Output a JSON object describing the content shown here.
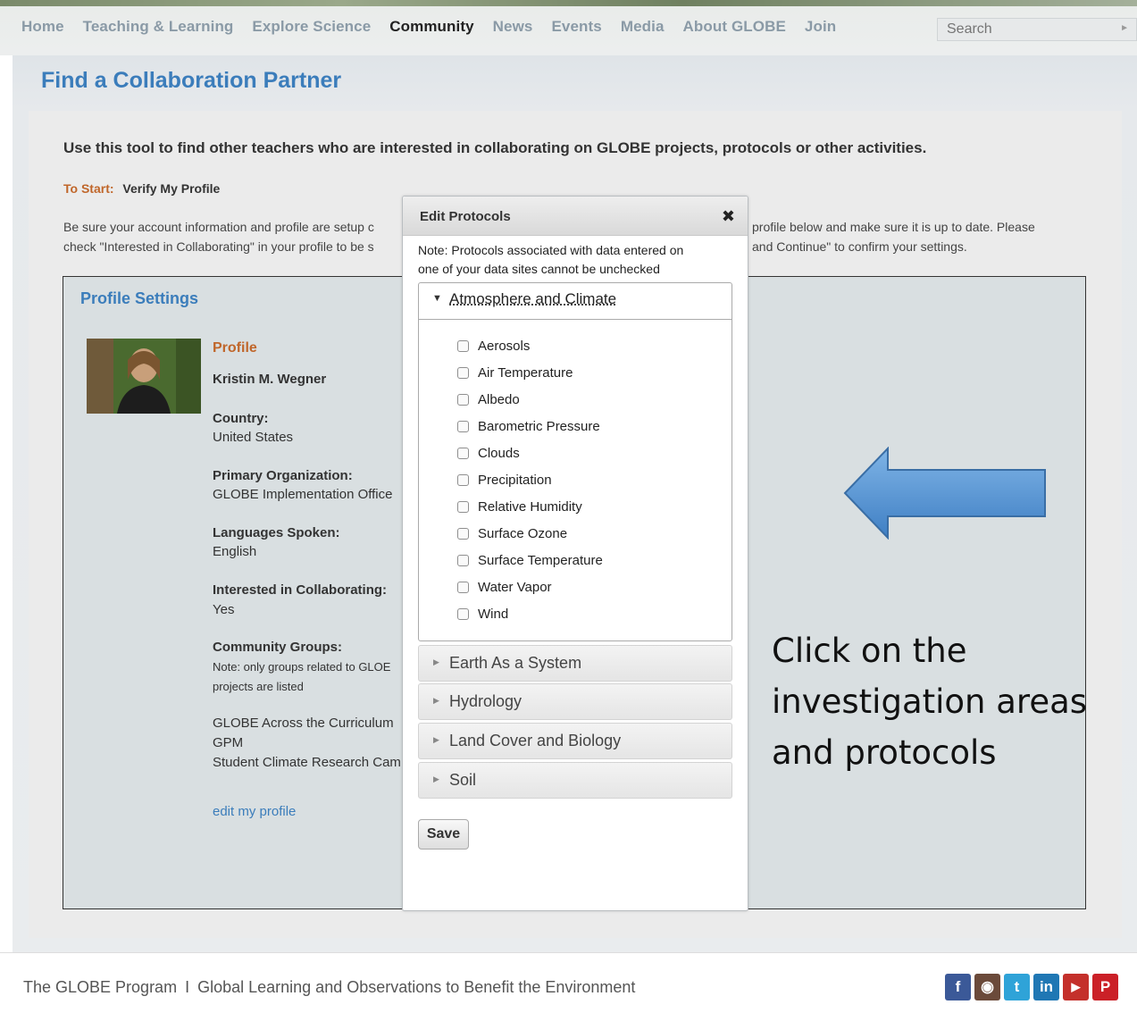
{
  "nav": {
    "items": [
      "Home",
      "Teaching & Learning",
      "Explore Science",
      "Community",
      "News",
      "Events",
      "Media",
      "About GLOBE",
      "Join"
    ],
    "active": "Community",
    "search_placeholder": "Search"
  },
  "page": {
    "title": "Find a Collaboration Partner",
    "intro": "Use this tool to find other teachers who are interested in collaborating on GLOBE projects, protocols or other activities.",
    "to_start_label": "To Start:",
    "to_start_value": "Verify My Profile",
    "para_left_1": "Be sure your account information and profile are setup c",
    "para_left_2": "check \"Interested in Collaborating\" in your profile to be s",
    "para_right_1": "profile below and make sure it is up to date. Please",
    "para_right_2": "and Continue\" to confirm your settings."
  },
  "profile": {
    "section_title": "Profile Settings",
    "heading": "Profile",
    "name": "Kristin M. Wegner",
    "country_label": "Country:",
    "country": "United States",
    "org_label": "Primary Organization:",
    "org": "GLOBE Implementation Office",
    "lang_label": "Languages Spoken:",
    "lang": "English",
    "collab_label": "Interested in Collaborating:",
    "collab": "Yes",
    "groups_label": "Community Groups:",
    "groups_note_1": "Note: only groups related to GLOE",
    "groups_note_2": "projects are listed",
    "groups": [
      "GLOBE Across the Curriculum",
      "GPM",
      "Student Climate Research Cam"
    ],
    "edit_link": "edit my profile"
  },
  "modal": {
    "title": "Edit Protocols",
    "close": "✖",
    "note_1": "Note: Protocols associated with data entered on",
    "note_2": "one of your data sites cannot be unchecked",
    "open_section": "Atmosphere and Climate",
    "protocols": [
      "Aerosols",
      "Air Temperature",
      "Albedo",
      "Barometric Pressure",
      "Clouds",
      "Precipitation",
      "Relative Humidity",
      "Surface Ozone",
      "Surface Temperature",
      "Water Vapor",
      "Wind"
    ],
    "closed_sections": [
      "Earth As a System",
      "Hydrology",
      "Land Cover and Biology",
      "Soil"
    ],
    "save_label": "Save"
  },
  "annotation": {
    "line1": "Click on the",
    "line2": "investigation areas",
    "line3": "and protocols",
    "arrow_color": "#5b9bd5"
  },
  "footer": {
    "program": "The GLOBE Program",
    "separator": "I",
    "tagline": "Global Learning and Observations to Benefit the Environment",
    "social": [
      {
        "name": "facebook-icon",
        "glyph": "f",
        "color": "#3b5998"
      },
      {
        "name": "instagram-icon",
        "glyph": "◉",
        "color": "#6b4a3a"
      },
      {
        "name": "twitter-icon",
        "glyph": "t",
        "color": "#2fa3d8"
      },
      {
        "name": "linkedin-icon",
        "glyph": "in",
        "color": "#1f77b4"
      },
      {
        "name": "youtube-icon",
        "glyph": "▶",
        "color": "#c4302b"
      },
      {
        "name": "pinterest-icon",
        "glyph": "P",
        "color": "#cb2027"
      }
    ]
  },
  "colors": {
    "link_blue": "#3b7dbb",
    "accent_orange": "#c0662a",
    "nav_inactive": "#8a9aa6"
  }
}
